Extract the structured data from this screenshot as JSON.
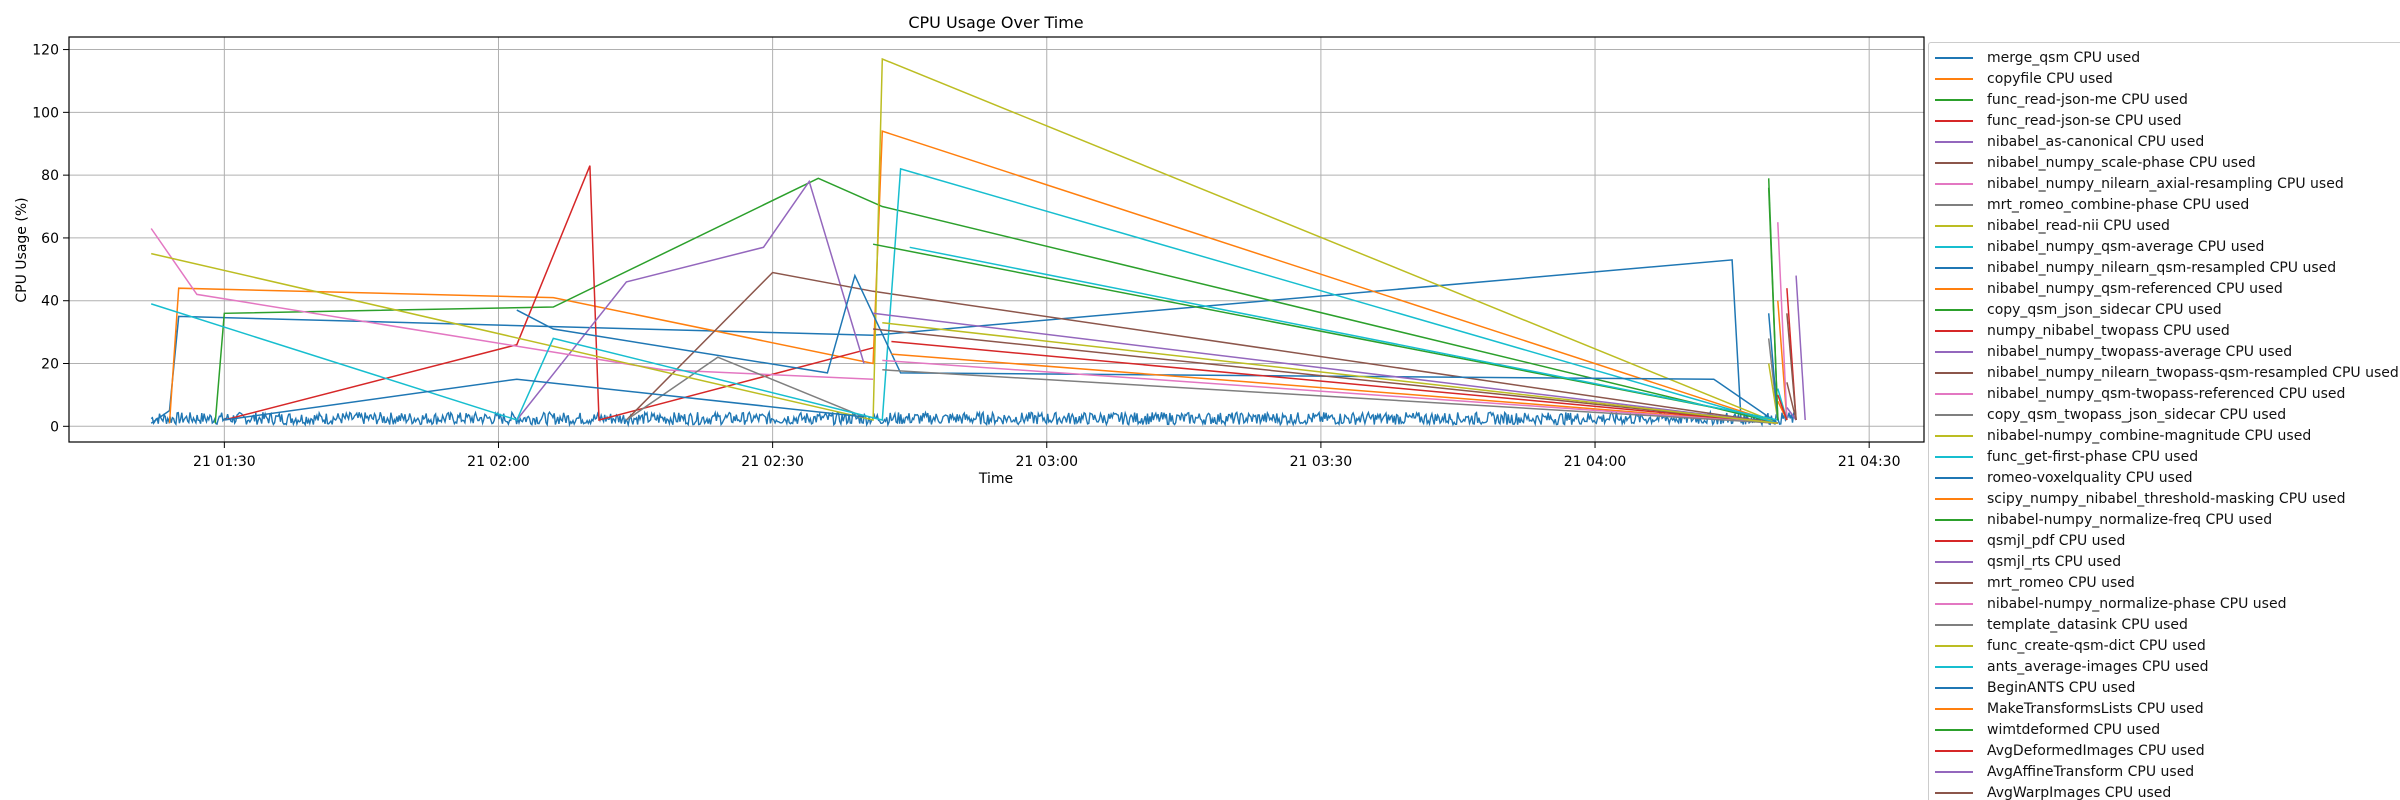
{
  "chart_data": {
    "type": "line",
    "title": "CPU Usage Over Time",
    "xlabel": "Time",
    "ylabel": "CPU Usage (%)",
    "xlim": [
      "2024-01-21 01:13",
      "2024-01-21 04:36"
    ],
    "ylim": [
      -5,
      124
    ],
    "yticks": [
      0,
      20,
      40,
      60,
      80,
      100,
      120
    ],
    "xticks": [
      {
        "t": "2024-01-21 01:30",
        "label": "21 01:30"
      },
      {
        "t": "2024-01-21 02:00",
        "label": "21 02:00"
      },
      {
        "t": "2024-01-21 02:30",
        "label": "21 02:30"
      },
      {
        "t": "2024-01-21 03:00",
        "label": "21 03:00"
      },
      {
        "t": "2024-01-21 03:30",
        "label": "21 03:30"
      },
      {
        "t": "2024-01-21 04:00",
        "label": "21 04:00"
      },
      {
        "t": "2024-01-21 04:30",
        "label": "21 04:30"
      }
    ],
    "grid": true,
    "legend_position": "right",
    "baseline_noise": {
      "start": "2024-01-21 01:22",
      "end": "2024-01-21 04:22",
      "min": 0.5,
      "max": 4.5
    },
    "series": [
      {
        "name": "merge_qsm CPU used",
        "color": "#1f77b4",
        "x": [
          "2024-01-21 01:22",
          "2024-01-21 01:24",
          "2024-01-21 01:25",
          "2024-01-21 02:41",
          "2024-01-21 04:15",
          "2024-01-21 04:16"
        ],
        "y": [
          1,
          5,
          35,
          29,
          53,
          1
        ]
      },
      {
        "name": "copyfile CPU used",
        "color": "#ff7f0e",
        "x": [
          "2024-01-21 01:24",
          "2024-01-21 01:25",
          "2024-01-21 02:06",
          "2024-01-21 02:41",
          "2024-01-21 02:42",
          "2024-01-21 04:20"
        ],
        "y": [
          1,
          44,
          41,
          20,
          94,
          1
        ]
      },
      {
        "name": "func_read-json-me CPU used",
        "color": "#2ca02c",
        "x": [
          "2024-01-21 01:29",
          "2024-01-21 01:30",
          "2024-01-21 02:06",
          "2024-01-21 02:35",
          "2024-01-21 02:42",
          "2024-01-21 04:20"
        ],
        "y": [
          1,
          36,
          38,
          79,
          70,
          1
        ]
      },
      {
        "name": "func_read-json-se CPU used",
        "color": "#d62728",
        "x": [
          "2024-01-21 01:30",
          "2024-01-21 02:02",
          "2024-01-21 02:10",
          "2024-01-21 02:11",
          "2024-01-21 02:41"
        ],
        "y": [
          2,
          26,
          83,
          2,
          25
        ]
      },
      {
        "name": "nibabel_as-canonical CPU used",
        "color": "#9467bd",
        "x": [
          "2024-01-21 02:02",
          "2024-01-21 02:14",
          "2024-01-21 02:29",
          "2024-01-21 02:34",
          "2024-01-21 02:40"
        ],
        "y": [
          2,
          46,
          57,
          78,
          20
        ]
      },
      {
        "name": "nibabel_numpy_scale-phase CPU used",
        "color": "#8c564b",
        "x": [
          "2024-01-21 02:14",
          "2024-01-21 02:30",
          "2024-01-21 02:41",
          "2024-01-21 04:20"
        ],
        "y": [
          2,
          49,
          43,
          1
        ]
      },
      {
        "name": "nibabel_numpy_nilearn_axial-resampling CPU used",
        "color": "#e377c2",
        "x": [
          "2024-01-21 01:22",
          "2024-01-21 01:27",
          "2024-01-21 02:18",
          "2024-01-21 02:41"
        ],
        "y": [
          63,
          42,
          18,
          15
        ]
      },
      {
        "name": "mrt_romeo_combine-phase CPU used",
        "color": "#7f7f7f",
        "x": [
          "2024-01-21 02:14",
          "2024-01-21 02:24",
          "2024-01-21 02:40"
        ],
        "y": [
          2,
          22,
          3
        ]
      },
      {
        "name": "nibabel_read-nii CPU used",
        "color": "#bcbd22",
        "x": [
          "2024-01-21 01:22",
          "2024-01-21 02:41",
          "2024-01-21 02:42",
          "2024-01-21 04:20"
        ],
        "y": [
          55,
          2,
          117,
          1
        ]
      },
      {
        "name": "nibabel_numpy_qsm-average CPU used",
        "color": "#17becf",
        "x": [
          "2024-01-21 01:22",
          "2024-01-21 02:02",
          "2024-01-21 02:06",
          "2024-01-21 02:42",
          "2024-01-21 02:44",
          "2024-01-21 04:20"
        ],
        "y": [
          39,
          2,
          28,
          2,
          82,
          1
        ]
      },
      {
        "name": "nibabel_numpy_nilearn_qsm-resampled CPU used",
        "color": "#1f77b4",
        "x": [
          "2024-01-21 02:02",
          "2024-01-21 02:06",
          "2024-01-21 02:36",
          "2024-01-21 02:39",
          "2024-01-21 02:44",
          "2024-01-21 04:13",
          "2024-01-21 04:20"
        ],
        "y": [
          37,
          31,
          17,
          48,
          17,
          15,
          1
        ]
      },
      {
        "name": "nibabel_numpy_qsm-referenced CPU used",
        "color": "#ff7f0e",
        "x": [
          "2024-01-21 02:43",
          "2024-01-21 04:20"
        ],
        "y": [
          23,
          1
        ]
      },
      {
        "name": "copy_qsm_json_sidecar CPU used",
        "color": "#2ca02c",
        "x": [
          "2024-01-21 02:41",
          "2024-01-21 04:20"
        ],
        "y": [
          58,
          2
        ]
      },
      {
        "name": "numpy_nibabel_twopass CPU used",
        "color": "#d62728",
        "x": [
          "2024-01-21 02:43",
          "2024-01-21 04:20"
        ],
        "y": [
          27,
          1
        ]
      },
      {
        "name": "nibabel_numpy_twopass-average CPU used",
        "color": "#9467bd",
        "x": [
          "2024-01-21 02:41",
          "2024-01-21 04:20"
        ],
        "y": [
          36,
          1
        ]
      },
      {
        "name": "nibabel_numpy_nilearn_twopass-qsm-resampled CPU used",
        "color": "#8c564b",
        "x": [
          "2024-01-21 02:41",
          "2024-01-21 04:20"
        ],
        "y": [
          31,
          1
        ]
      },
      {
        "name": "nibabel_numpy_qsm-twopass-referenced CPU used",
        "color": "#e377c2",
        "x": [
          "2024-01-21 02:42",
          "2024-01-21 04:20"
        ],
        "y": [
          21,
          1
        ]
      },
      {
        "name": "copy_qsm_twopass_json_sidecar CPU used",
        "color": "#7f7f7f",
        "x": [
          "2024-01-21 02:42",
          "2024-01-21 04:20"
        ],
        "y": [
          18,
          1
        ]
      },
      {
        "name": "nibabel-numpy_combine-magnitude CPU used",
        "color": "#bcbd22",
        "x": [
          "2024-01-21 02:42",
          "2024-01-21 04:20"
        ],
        "y": [
          33,
          1
        ]
      },
      {
        "name": "func_get-first-phase CPU used",
        "color": "#17becf",
        "x": [
          "2024-01-21 02:45",
          "2024-01-21 04:20"
        ],
        "y": [
          57,
          2
        ]
      },
      {
        "name": "romeo-voxelquality CPU used",
        "color": "#1f77b4",
        "x": [
          "2024-01-21 01:30",
          "2024-01-21 02:02",
          "2024-01-21 02:40"
        ],
        "y": [
          2,
          15,
          3
        ]
      },
      {
        "name": "scipy_numpy_nibabel_threshold-masking CPU used",
        "color": "#ff7f0e",
        "x": [
          "2024-01-21 04:20",
          "2024-01-21 04:21"
        ],
        "y": [
          40,
          2
        ]
      },
      {
        "name": "nibabel-numpy_normalize-freq CPU used",
        "color": "#2ca02c",
        "x": [
          "2024-01-21 04:19",
          "2024-01-21 04:20"
        ],
        "y": [
          79,
          2
        ]
      },
      {
        "name": "qsmjl_pdf CPU used",
        "color": "#d62728",
        "x": [
          "2024-01-21 04:21",
          "2024-01-21 04:22"
        ],
        "y": [
          44,
          2
        ]
      },
      {
        "name": "qsmjl_rts CPU used",
        "color": "#9467bd",
        "x": [
          "2024-01-21 04:22",
          "2024-01-21 04:23"
        ],
        "y": [
          48,
          2
        ]
      },
      {
        "name": "mrt_romeo CPU used",
        "color": "#8c564b",
        "x": [
          "2024-01-21 04:21",
          "2024-01-21 04:22"
        ],
        "y": [
          36,
          2
        ]
      },
      {
        "name": "nibabel-numpy_normalize-phase CPU used",
        "color": "#e377c2",
        "x": [
          "2024-01-21 04:20",
          "2024-01-21 04:21"
        ],
        "y": [
          65,
          2
        ]
      },
      {
        "name": "template_datasink CPU used",
        "color": "#7f7f7f",
        "x": [
          "2024-01-21 04:19",
          "2024-01-21 04:20"
        ],
        "y": [
          28,
          2
        ]
      },
      {
        "name": "func_create-qsm-dict CPU used",
        "color": "#bcbd22",
        "x": [
          "2024-01-21 04:19",
          "2024-01-21 04:20"
        ],
        "y": [
          20,
          2
        ]
      },
      {
        "name": "ants_average-images CPU used",
        "color": "#17becf",
        "x": [
          "2024-01-21 04:20",
          "2024-01-21 04:21"
        ],
        "y": [
          12,
          2
        ]
      },
      {
        "name": "BeginANTS CPU used",
        "color": "#1f77b4",
        "x": [
          "2024-01-21 04:19",
          "2024-01-21 04:20"
        ],
        "y": [
          36,
          2
        ]
      },
      {
        "name": "MakeTransformsLists CPU used",
        "color": "#ff7f0e",
        "x": [
          "2024-01-21 04:20",
          "2024-01-21 04:21"
        ],
        "y": [
          8,
          2
        ]
      },
      {
        "name": "wimtdeformed CPU used",
        "color": "#2ca02c",
        "x": [
          "2024-01-21 04:19",
          "2024-01-21 04:20"
        ],
        "y": [
          76,
          2
        ]
      },
      {
        "name": "AvgDeformedImages CPU used",
        "color": "#d62728",
        "x": [
          "2024-01-21 04:20",
          "2024-01-21 04:21"
        ],
        "y": [
          10,
          2
        ]
      },
      {
        "name": "AvgAffineTransform CPU used",
        "color": "#9467bd",
        "x": [
          "2024-01-21 04:21",
          "2024-01-21 04:22"
        ],
        "y": [
          6,
          2
        ]
      },
      {
        "name": "AvgWarpImages CPU used",
        "color": "#8c564b",
        "x": [
          "2024-01-21 04:21",
          "2024-01-21 04:22"
        ],
        "y": [
          14,
          2
        ]
      }
    ]
  }
}
